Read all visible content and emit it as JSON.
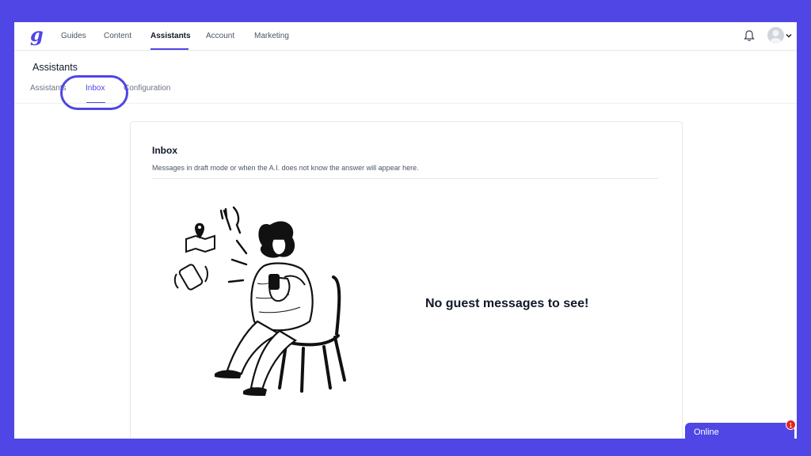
{
  "nav": {
    "logo_alt": "g",
    "items": [
      {
        "label": "Guides"
      },
      {
        "label": "Content"
      },
      {
        "label": "Assistants"
      },
      {
        "label": "Account"
      },
      {
        "label": "Marketing"
      }
    ],
    "active": "Assistants"
  },
  "page": {
    "title": "Assistants",
    "tabs": [
      {
        "label": "Assistants"
      },
      {
        "label": "Inbox"
      },
      {
        "label": "Configuration"
      }
    ],
    "active_tab": "Inbox"
  },
  "inbox": {
    "title": "Inbox",
    "description": "Messages in draft mode or when the A.I. does not know the answer will appear here.",
    "empty_message": "No guest messages to see!"
  },
  "chat_widget": {
    "label": "Online",
    "badge_count": "1"
  },
  "colors": {
    "accent": "#4f46e5",
    "badge": "#dc2626"
  },
  "icons": [
    "bell-icon",
    "avatar",
    "chevron-down-icon",
    "logo-icon"
  ]
}
